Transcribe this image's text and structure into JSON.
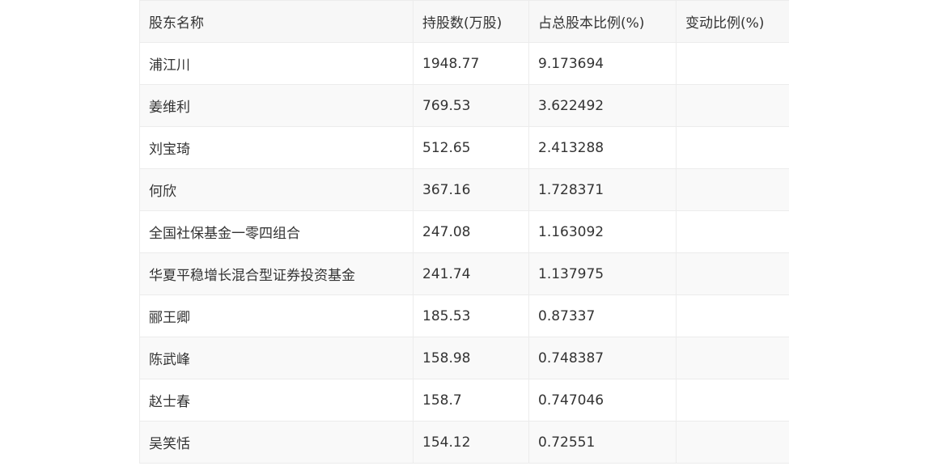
{
  "table": {
    "headers": [
      "股东名称",
      "持股数(万股)",
      "占总股本比例(%)",
      "变动比例(%)"
    ],
    "rows": [
      [
        "浦江川",
        "1948.77",
        "9.173694",
        ""
      ],
      [
        "姜维利",
        "769.53",
        "3.622492",
        ""
      ],
      [
        "刘宝琦",
        "512.65",
        "2.413288",
        ""
      ],
      [
        "何欣",
        "367.16",
        "1.728371",
        ""
      ],
      [
        "全国社保基金一零四组合",
        "247.08",
        "1.163092",
        ""
      ],
      [
        "华夏平稳增长混合型证券投资基金",
        "241.74",
        "1.137975",
        ""
      ],
      [
        "郦王卿",
        "185.53",
        "0.87337",
        ""
      ],
      [
        "陈武峰",
        "158.98",
        "0.748387",
        ""
      ],
      [
        "赵士春",
        "158.7",
        "0.747046",
        ""
      ],
      [
        "吴笑恬",
        "154.12",
        "0.72551",
        ""
      ]
    ]
  }
}
